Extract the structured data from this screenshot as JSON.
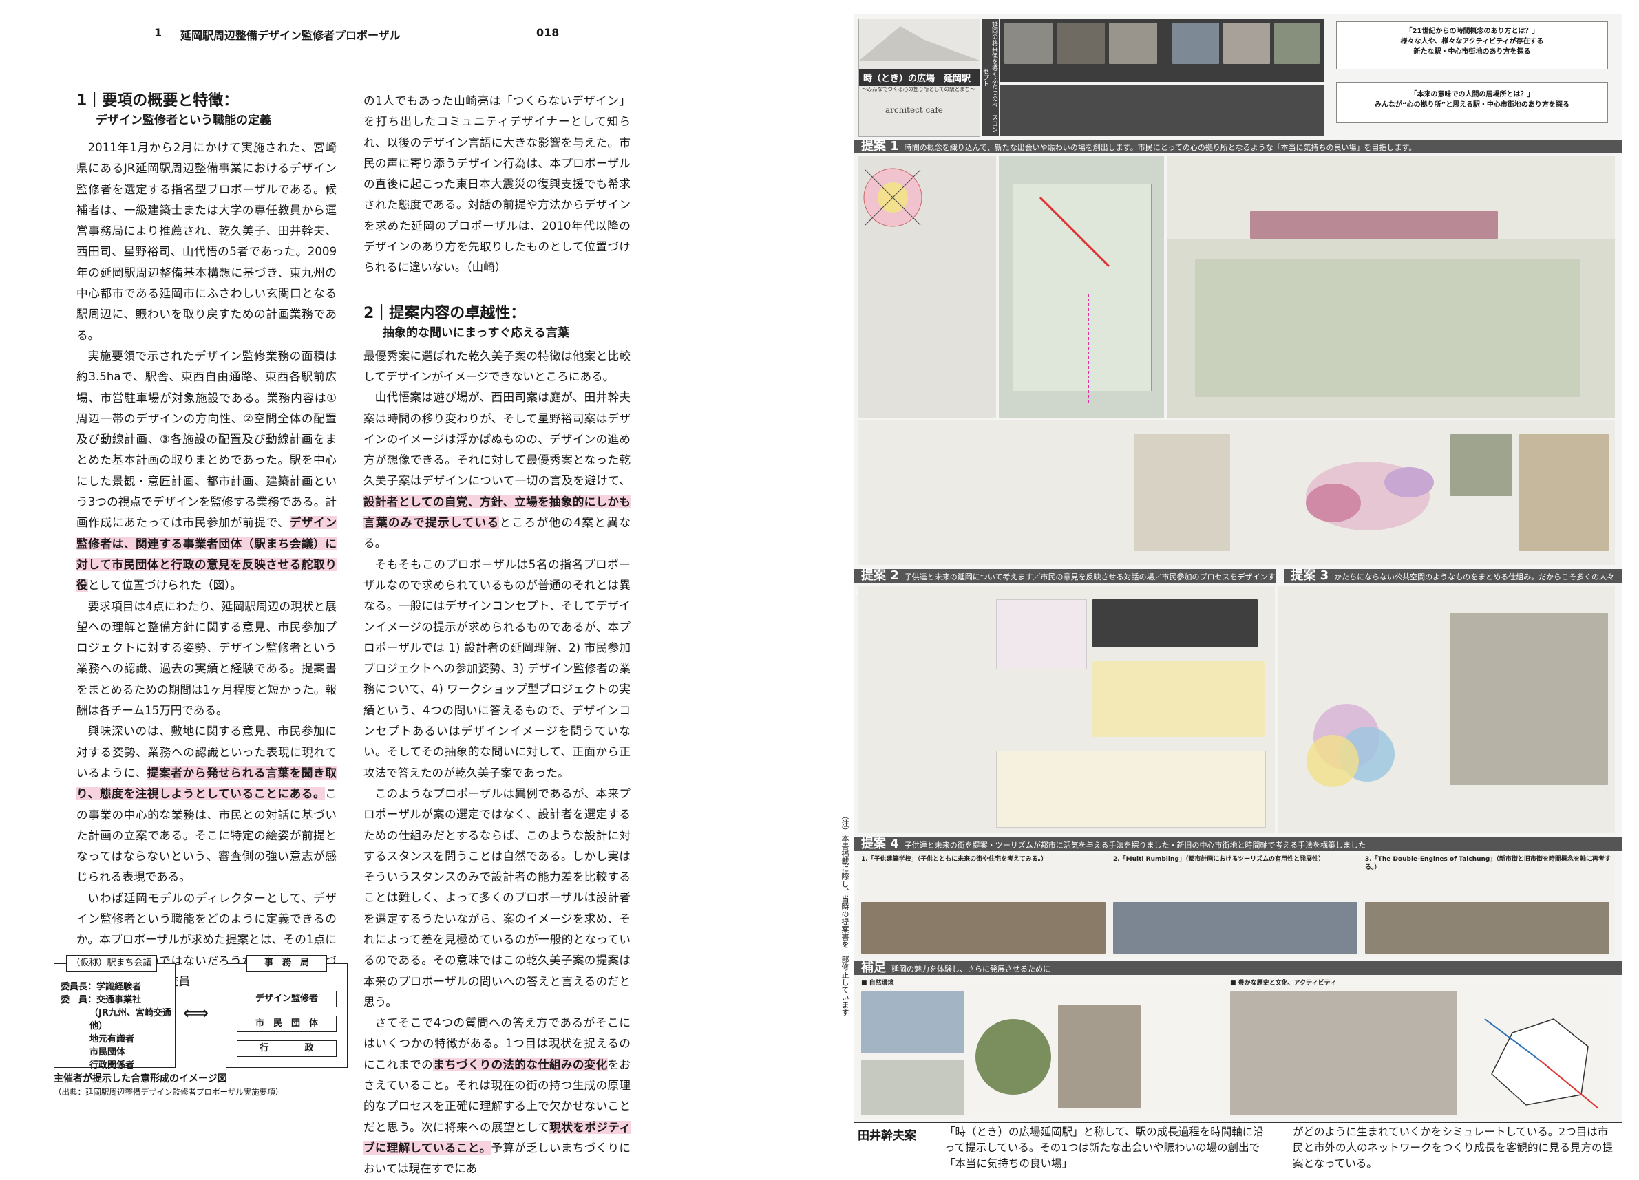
{
  "header": {
    "chapter": "1",
    "running_title": "延岡駅周辺整備デザイン監修者プロポーザル",
    "page_number": "018"
  },
  "section1": {
    "title": "1｜要項の概要と特徴：",
    "subtitle": "デザイン監修者という職能の定義"
  },
  "section2": {
    "title": "2｜提案内容の卓越性：",
    "subtitle": "抽象的な問いにまっすぐ応える言葉"
  },
  "col1": {
    "p1": "2011年1月から2月にかけて実施された、宮崎県にあるJR延岡駅周辺整備事業におけるデザイン監修者を選定する指名型プロポーザルである。候補者は、一級建築士または大学の専任教員から運営事務局により推薦され、乾久美子、田井幹夫、西田司、星野裕司、山代悟の5者であった。2009年の延岡駅周辺整備基本構想に基づき、東九州の中心都市である延岡市にふさわしい玄関口となる駅周辺に、賑わいを取り戻すための計画業務である。",
    "p2a": "実施要領で示されたデザイン監修業務の面積は約3.5haで、駅舎、東西自由通路、東西各駅前広場、市営駐車場が対象施設である。業務内容は①周辺一帯のデザインの方向性、②空間全体の配置及び動線計画、③各施設の配置及び動線計画をまとめた基本計画の取りまとめであった。駅を中心にした景観・意匠計画、都市計画、建築計画という3つの視点でデザインを監修する業務である。計画作成にあたっては市民参加が前提で、",
    "p2hl": "デザイン監修者は、関連する事業者団体（駅まち会議）に対して市民団体と行政の意見を反映させる舵取り役",
    "p2b": "として位置づけられた（図）。",
    "p3": "要求項目は4点にわたり、延岡駅周辺の現状と展望への理解と整備方針に関する意見、市民参加プロジェクトに対する姿勢、デザイン監修者という業務への認識、過去の実績と経験である。提案書をまとめるための期間は1ヶ月程度と短かった。報酬は各チーム15万円である。",
    "p4a": "興味深いのは、敷地に関する意見、市民参加に対する姿勢、業務への認識といった表現に現れているように、",
    "p4hl": "提案者から発せられる言葉を聞き取り、態度を注視しようとしていることにある。",
    "p4b": "この事業の中心的な業務は、市民との対話に基づいた計画の立案である。そこに特定の絵姿が前提となってはならないという、審査側の強い意志が感じられる表現である。",
    "p5": "いわば延岡モデルのディレクターとして、デザイン監修者という職能をどのように定義できるのか。本プロポーザルが求めた提案とは、その1点にかかっていたのではないだろうか。延岡のまちづくりに関わり、審査員"
  },
  "col2": {
    "p1": "の1人でもあった山崎亮は「つくらないデザイン」を打ち出したコミュニティデザイナーとして知られ、以後のデザイン言語に大きな影響を与えた。市民の声に寄り添うデザイン行為は、本プロポーザルの直後に起こった東日本大震災の復興支援でも希求された態度である。対話の前提や方法からデザインを求めた延岡のプロポーザルは、2010年代以降のデザインのあり方を先取りしたものとして位置づけられるに違いない。（山崎）",
    "p2": "最優秀案に選ばれた乾久美子案の特徴は他案と比較してデザインがイメージできないところにある。",
    "p3a": "山代悟案は遊び場が、西田司案は庭が、田井幹夫案は時間の移り変わりが、そして星野裕司案はデザインのイメージは浮かばぬものの、デザインの進め方が想像できる。それに対して最優秀案となった乾久美子案はデザインについて一切の言及を避けて、",
    "p3hl": "設計者としての自覚、方針、立場を抽象的にしかも言葉のみで提示している",
    "p3b": "ところが他の4案と異なる。",
    "p4": "そもそもこのプロポーザルは5名の指名プロポーザルなので求められているものが普通のそれとは異なる。一般にはデザインコンセプト、そしてデザインイメージの提示が求められるものであるが、本プロポーザルでは 1) 設計者の延岡理解、2) 市民参加プロジェクトへの参加姿勢、3) デザイン監修者の業務について、4) ワークショップ型プロジェクトの実績という、4つの問いに答えるもので、デザインコンセプトあるいはデザインイメージを問うていない。そしてその抽象的な問いに対して、正面から正攻法で答えたのが乾久美子案であった。",
    "p5": "このようなプロポーザルは異例であるが、本来プロポーザルが案の選定ではなく、設計者を選定するための仕組みだとするならば、このような設計に対するスタンスを問うことは自然である。しかし実はそういうスタンスのみで設計者の能力差を比較することは難しく、よって多くのプロポーザルは設計者を選定するうたいながら、案のイメージを求め、それによって差を見極めているのが一般的となっているのである。その意味ではこの乾久美子案の提案は本来のプロポーザルの問いへの答えと言えるのだと思う。",
    "p6a": "さてそこで4つの質問への答え方であるがそこにはいくつかの特徴がある。1つ目は現状を捉えるのにこれまでの",
    "p6hl1": "まちづくりの法的な仕組みの変化",
    "p6b": "をおさえていること。それは現在の街の持つ生成の原理的なプロセスを正確に理解する上で欠かせないことだと思う。次に将来への展望として",
    "p6hl2": "現状をポジティブに理解していること。",
    "p6c": "予算が乏しいまちづくりにおいては現在すでにあ"
  },
  "figure": {
    "left_box_title": "（仮称）駅まち会議",
    "chair_label": "委員長：学識経験者",
    "members_label": "委　員：交通事業社",
    "members_list": [
      "（JR九州、宮崎交通他）",
      "地元有識者",
      "市民団体",
      "行政関係者"
    ],
    "arrow": "⟺",
    "right_box_title": "事　務　局",
    "right_items": [
      "デザイン監修者",
      "市　民　団　体",
      "行　　　　政"
    ],
    "caption": "主催者が提示した合意形成のイメージ図",
    "source": "（出典：延岡駅周辺整備デザイン監修者プロポーザル実施要項）"
  },
  "right_page": {
    "panel_title": "時（とき）の広場　延岡駅",
    "panel_subtitle": "〜みんなでつくる心の拠り所としての駅とまち〜",
    "logo_text": "architect cafe",
    "concept_vertical": "延岡の将来像を導くふたつのベースコンセプト",
    "concept_q1": "「21世紀からの時間概念のあり方とは？」\n様々な人や、様々なアクティビティが存在する\n新たな駅・中心市街地のあり方を探る",
    "concept_q2": "「本来の意味での人間の居場所とは？」\nみんなが“心の拠り所”と思える駅・中心市街地のあり方を探る",
    "p1_label": "提案 1",
    "p1_text": "時間の概念を織り込んで、新たな出会いや賑わいの場を創出します。市民にとっての心の拠り所となるような「本当に気持ちの良い場」を目指します。",
    "p2_label": "提案 2",
    "p2_text": "子供達と未来の延岡について考えます／市民の意見を反映させる対話の場／市民参加のプロセスをデザインする",
    "p3_label": "提案 3",
    "p3_text": "かたちにならない公共空間のようなものをまとめる仕組み。だからこそ多くの人々の対話を通じ、且良きことを目指していきます。",
    "p4_label": "提案 4",
    "p4_text": "子供達と未来の街を提案・ツーリズムが都市に活気を与える手法を探りました・新旧の中心市街地と時間軸で考える手法を構築しました",
    "p4_items": [
      "1.「子供建築学校」（子供とともに未来の街や住宅を考えてみる。）",
      "2.「Multi Rumbling」（都市計画におけるツーリズムの有用性と発展性）",
      "3.「The Double-Engines of Taichung」（新市街と旧市街を時間概念を軸に再考する。）"
    ],
    "supp_label": "補足",
    "supp_text": "延岡の魅力を体験し、さらに発展させるために",
    "supp_heads": [
      "■ 自然環境",
      "■ 豊かな歴史と文化、アクティビティ"
    ],
    "vertical_note": "（注）本書掲載に際し、当時の提案書を一部修正しています",
    "credit": "田井幹夫案",
    "bottom_text_1": "「時（とき）の広場延岡駅」と称して、駅の成長過程を時間軸に沿って提示している。その1つは新たな出会いや賑わいの場の創出で「本当に気持ちの良い場」",
    "bottom_text_2": "がどのように生まれていくかをシミュレートしている。2つ目は市民と市外の人のネットワークをつくり成長を客観的に見る見方の提案となっている。"
  },
  "colors": {
    "highlight": "#f6d3de",
    "band": "#555555",
    "text": "#1a1a1a"
  }
}
